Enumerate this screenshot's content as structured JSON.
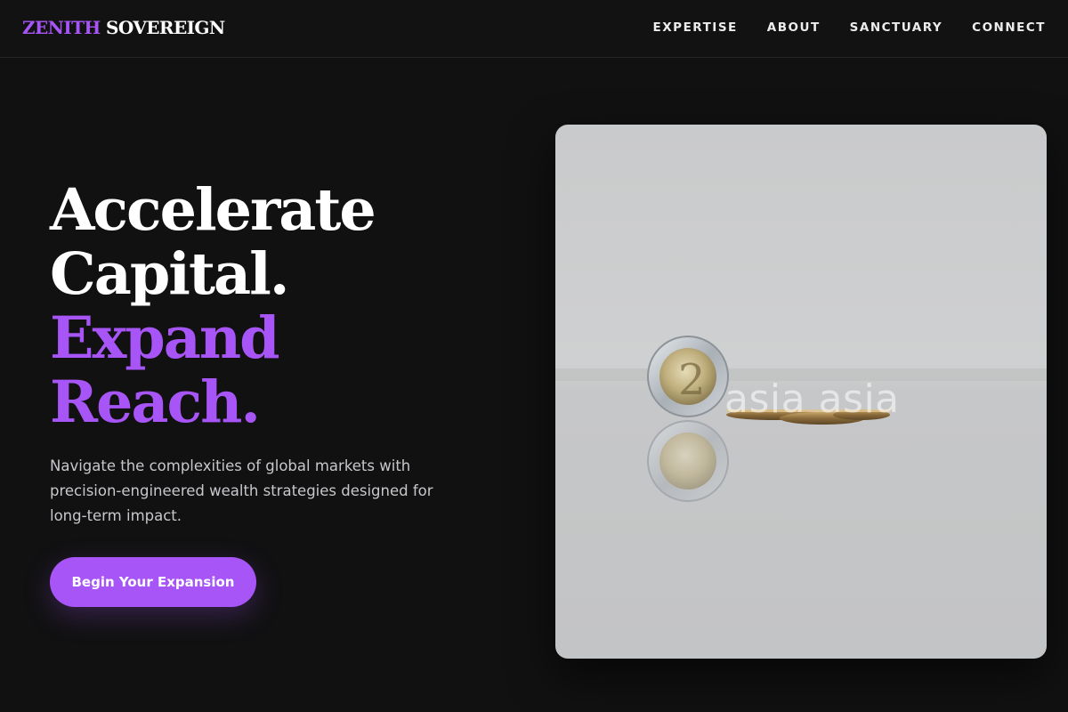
{
  "brand": {
    "part1": "ZENITH",
    "part2": "SOVEREIGN"
  },
  "nav": {
    "items": [
      {
        "label": "EXPERTISE"
      },
      {
        "label": "ABOUT"
      },
      {
        "label": "SANCTUARY"
      },
      {
        "label": "CONNECT"
      }
    ]
  },
  "hero": {
    "headline": {
      "line1": "Accelerate",
      "line2": "Capital.",
      "line3": "Expand",
      "line4": "Reach."
    },
    "subcopy": "Navigate the complexities of global markets with precision-engineered wealth strategies designed for long-term impact.",
    "cta_label": "Begin Your Expansion",
    "image": {
      "watermark": "asia asia",
      "coin_digit": "2"
    }
  },
  "colors": {
    "accent": "#a855f7",
    "background": "#111112",
    "text_primary": "#ffffff",
    "text_secondary": "#c7c7cc"
  }
}
